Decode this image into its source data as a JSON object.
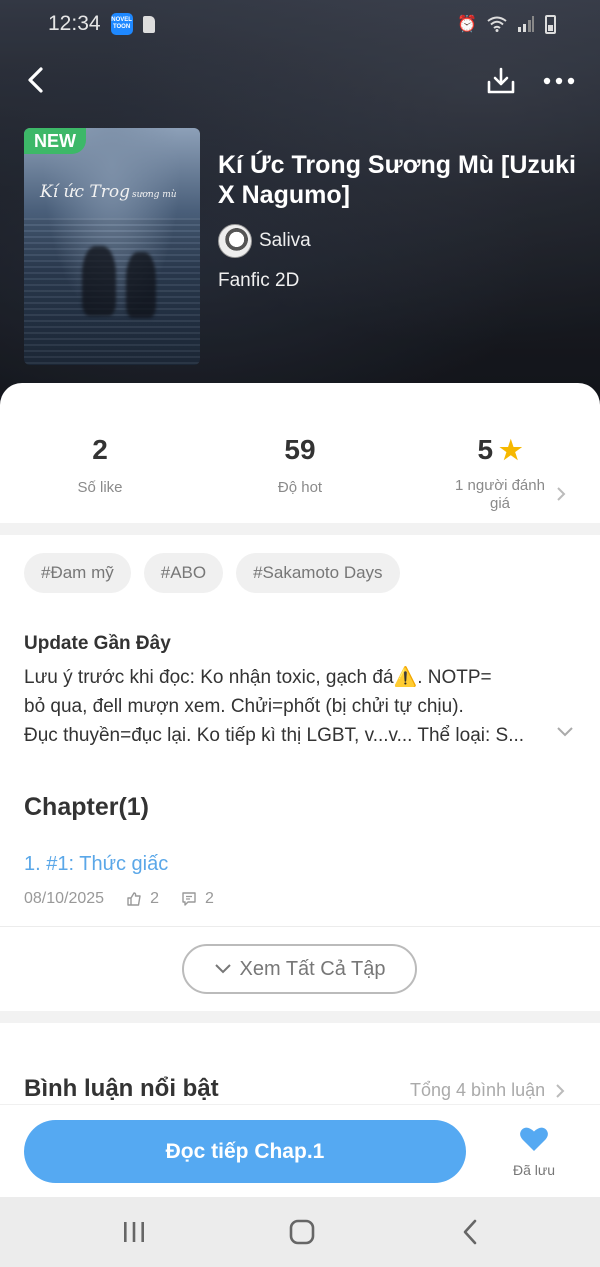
{
  "status_bar": {
    "time": "12:34",
    "app_badge_text": "NOVEL TOON"
  },
  "book": {
    "badge": "NEW",
    "cover_title": "Kí ức Trog",
    "cover_subtitle": "sương mù",
    "title": "Kí Ức Trong Sương Mù [Uzuki X Nagumo]",
    "author": "Saliva",
    "genre": "Fanfic 2D"
  },
  "stats": {
    "likes_value": "2",
    "likes_label": "Số like",
    "hot_value": "59",
    "hot_label": "Độ hot",
    "rating_value": "5",
    "rating_label": "1 người đánh giá"
  },
  "tags": [
    "#Đam mỹ",
    "#ABO",
    "#Sakamoto Days"
  ],
  "update": {
    "title": "Update Gần Đây",
    "line1": "Lưu ý trước khi đọc: Ko nhận toxic, gạch đá⚠️. NOTP=",
    "line2": "bỏ qua, đell mượn xem. Chửi=phốt (bị chửi tự chịu).",
    "line3": "Đục thuyền=đục lại. Ko tiếp kì thị LGBT, v...v... Thể loại: S..."
  },
  "chapters": {
    "heading": "Chapter(1)",
    "items": [
      {
        "title": "1. #1: Thức giấc",
        "date": "08/10/2025",
        "likes": "2",
        "comments": "2"
      }
    ],
    "view_all_label": "Xem Tất Cả Tập"
  },
  "comments": {
    "title": "Bình luận nổi bật",
    "total_label": "Tổng 4 bình luận"
  },
  "actions": {
    "read_label": "Đọc tiếp Chap.1",
    "saved_label": "Đã lưu"
  },
  "colors": {
    "accent": "#55a9f2",
    "chapter_link": "#5aa7e8",
    "new_badge": "#3db868",
    "star": "#f6b800"
  }
}
